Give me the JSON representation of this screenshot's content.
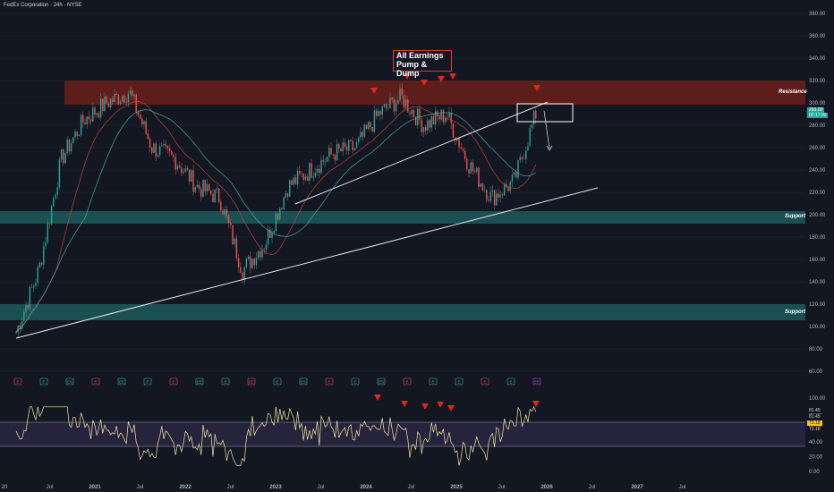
{
  "header": {
    "title": "FedEx Corporation · 24h · NYSE"
  },
  "annotation": {
    "line1": "All Earnings",
    "line2": "Pump & Dump"
  },
  "zones": {
    "resistance": "Resistance",
    "support_upper": "Support",
    "support_lower": "Support"
  },
  "colors": {
    "background": "#131722",
    "resistance_zone": "#6b1f1a",
    "support_zone": "#1d5a5a",
    "trendline": "#e6e6e6",
    "arrow": "#d9281c",
    "rsi_line": "#f2e6a6",
    "rsi_band": "#5b4a8a"
  },
  "price_scale": {
    "labels": [
      "380.00",
      "360.00",
      "340.00",
      "320.00",
      "300.00",
      "280.00",
      "260.00",
      "240.00",
      "220.00",
      "200.00",
      "180.00",
      "160.00",
      "140.00",
      "120.00",
      "100.00",
      "80.00",
      "60.00"
    ]
  },
  "price_tags": {
    "last": "293.00",
    "timer": "02:17:30"
  },
  "rsi_scale": {
    "labels": [
      "100.00",
      "80.00",
      "60.00",
      "40.00",
      "20.00",
      "0.00"
    ]
  },
  "rsi_tags": {
    "a": "81.45",
    "b": "81.45",
    "c": "73.18",
    "d": "73.18"
  },
  "time_axis": {
    "labels": [
      "20",
      "Jul",
      "2021",
      "Jul",
      "2022",
      "Jul",
      "2023",
      "Jul",
      "2024",
      "Jul",
      "2025",
      "Jul",
      "2026",
      "Jul",
      "2027",
      "Jul"
    ]
  },
  "earnings_markers": [
    "E",
    "E",
    "ES",
    "E",
    "EE",
    "E",
    "E",
    "EE",
    "E",
    "EE",
    "E",
    "ES",
    "E",
    "E",
    "ES",
    "E",
    "E",
    "E",
    "E",
    "E",
    "EE"
  ],
  "chart_data": {
    "type": "line",
    "title": "FedEx Corporation · 24h · NYSE",
    "x": [
      "2020-03",
      "2020-06",
      "2020-09",
      "2020-12",
      "2021-03",
      "2021-06",
      "2021-09",
      "2021-12",
      "2022-03",
      "2022-06",
      "2022-09",
      "2022-12",
      "2023-03",
      "2023-06",
      "2023-09",
      "2023-12",
      "2024-03",
      "2024-06",
      "2024-09",
      "2024-12",
      "2025-03",
      "2025-06",
      "2025-09",
      "2025-12"
    ],
    "series": [
      {
        "values": [
          95,
          150,
          250,
          285,
          300,
          310,
          260,
          250,
          225,
          215,
          150,
          175,
          225,
          240,
          255,
          260,
          290,
          305,
          280,
          290,
          245,
          215,
          230,
          293
        ]
      }
    ],
    "ylim": [
      60,
      390
    ],
    "resistance_zone": [
      298,
      320
    ],
    "support_zones": [
      [
        192,
        203
      ],
      [
        105,
        120
      ]
    ],
    "rsi": {
      "ylim": [
        0,
        100
      ],
      "levels": [
        30,
        70
      ],
      "last": 81.45
    }
  }
}
